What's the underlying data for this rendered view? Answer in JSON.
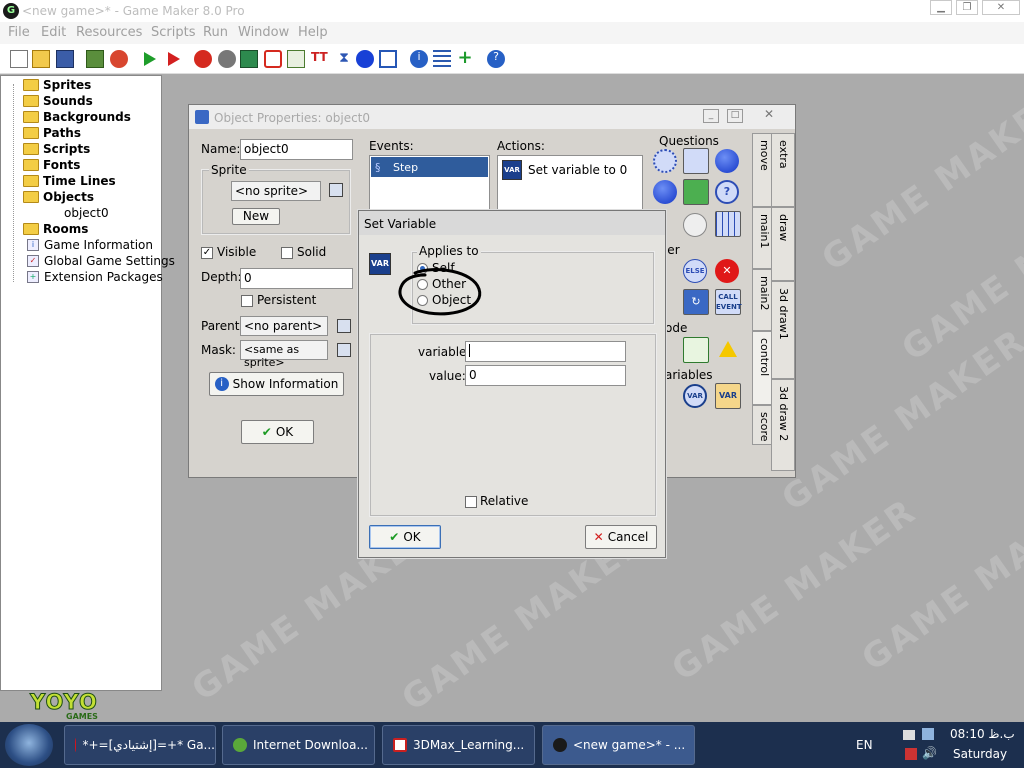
{
  "app": {
    "title": "<new game>* - Game Maker 8.0 Pro",
    "menus": [
      "File",
      "Edit",
      "Resources",
      "Scripts",
      "Run",
      "Window",
      "Help"
    ]
  },
  "tree": {
    "items": [
      {
        "label": "Sprites",
        "icon": "folder-icon"
      },
      {
        "label": "Sounds",
        "icon": "folder-icon"
      },
      {
        "label": "Backgrounds",
        "icon": "folder-icon"
      },
      {
        "label": "Paths",
        "icon": "folder-icon"
      },
      {
        "label": "Scripts",
        "icon": "folder-icon"
      },
      {
        "label": "Fonts",
        "icon": "folder-icon"
      },
      {
        "label": "Time Lines",
        "icon": "folder-icon"
      },
      {
        "label": "Objects",
        "icon": "folder-icon"
      },
      {
        "label": "object0",
        "icon": "none"
      },
      {
        "label": "Rooms",
        "icon": "folder-icon"
      },
      {
        "label": "Game Information",
        "icon": "info-icon"
      },
      {
        "label": "Global Game Settings",
        "icon": "settings-icon"
      },
      {
        "label": "Extension Packages",
        "icon": "plus-icon"
      }
    ],
    "logo": "YOYO",
    "logo_sub": "GAMES"
  },
  "object_props": {
    "title": "Object Properties: object0",
    "name_label": "Name:",
    "name_value": "object0",
    "sprite_group": "Sprite",
    "sprite_value": "<no sprite>",
    "new_button": "New",
    "visible_label": "Visible",
    "visible_checked": true,
    "solid_label": "Solid",
    "solid_checked": false,
    "depth_label": "Depth:",
    "depth_value": "0",
    "persistent_label": "Persistent",
    "parent_label": "Parent:",
    "parent_value": "<no parent>",
    "mask_label": "Mask:",
    "mask_value": "<same as sprite>",
    "show_info_button": "Show Information",
    "ok_button": "OK",
    "events_label": "Events:",
    "events": [
      "Step"
    ],
    "actions_label": "Actions:",
    "actions": [
      "Set variable  to 0"
    ],
    "questions_label": "Questions",
    "other_label": "ther",
    "code_label": "ode",
    "variables_label": "ariables",
    "tabs_right": [
      "extra",
      "draw",
      "3d draw1",
      "3d draw 2"
    ],
    "tabs_left": [
      "move",
      "main1",
      "main2",
      "control",
      "score"
    ]
  },
  "set_variable": {
    "title": "Set Variable",
    "applies_to_label": "Applies to",
    "options": [
      "Self",
      "Other",
      "Object"
    ],
    "selected": "Self",
    "variable_label": "variable:",
    "variable_value": "",
    "value_label": "value:",
    "value_value": "0",
    "relative_label": "Relative",
    "relative_checked": false,
    "ok_button": "OK",
    "cancel_button": "Cancel"
  },
  "taskbar": {
    "buttons": [
      "*+=[إشتيادي]=+* Ga...",
      "Internet Downloa...",
      "3DMax_Learning...",
      "<new game>* - ..."
    ],
    "language": "EN",
    "time": "08:10 ب.ظ",
    "day": "Saturday"
  },
  "watermark_text": "GAME MAKER",
  "colors": {
    "workspace": "#ababab",
    "taskbar": "#1c2f4e",
    "selection": "#2f5c9c",
    "annotation_circle": "#000000"
  }
}
